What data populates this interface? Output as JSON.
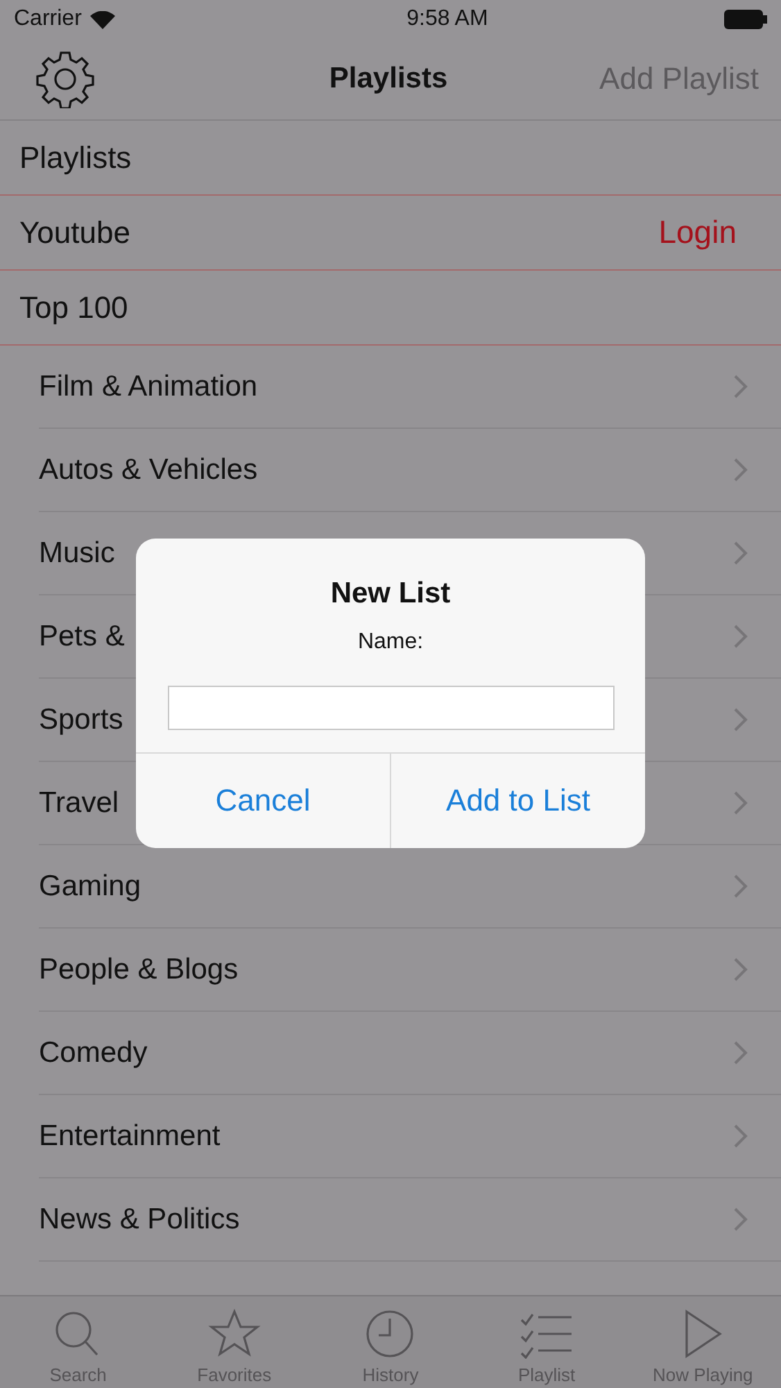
{
  "status_bar": {
    "carrier": "Carrier",
    "time": "9:58 AM"
  },
  "nav": {
    "title": "Playlists",
    "action": "Add Playlist"
  },
  "sections": [
    {
      "label": "Playlists"
    },
    {
      "label": "Youtube",
      "action": "Login"
    },
    {
      "label": "Top 100"
    }
  ],
  "categories": [
    {
      "label": "Film & Animation"
    },
    {
      "label": "Autos & Vehicles"
    },
    {
      "label": "Music"
    },
    {
      "label": "Pets &"
    },
    {
      "label": "Sports"
    },
    {
      "label": "Travel"
    },
    {
      "label": "Gaming"
    },
    {
      "label": "People & Blogs"
    },
    {
      "label": "Comedy"
    },
    {
      "label": "Entertainment"
    },
    {
      "label": "News & Politics"
    }
  ],
  "dialog": {
    "title": "New List",
    "message": "Name:",
    "buttons": [
      "Cancel",
      "Add to List"
    ]
  },
  "tab_bar": [
    {
      "kind": "search",
      "label": "Search",
      "selected": false
    },
    {
      "kind": "star",
      "label": "Favorites",
      "selected": false
    },
    {
      "kind": "clock",
      "label": "History",
      "selected": false
    },
    {
      "kind": "checklist",
      "label": "Playlist",
      "selected": false
    },
    {
      "kind": "play",
      "label": "Now Playing",
      "selected": false
    }
  ]
}
